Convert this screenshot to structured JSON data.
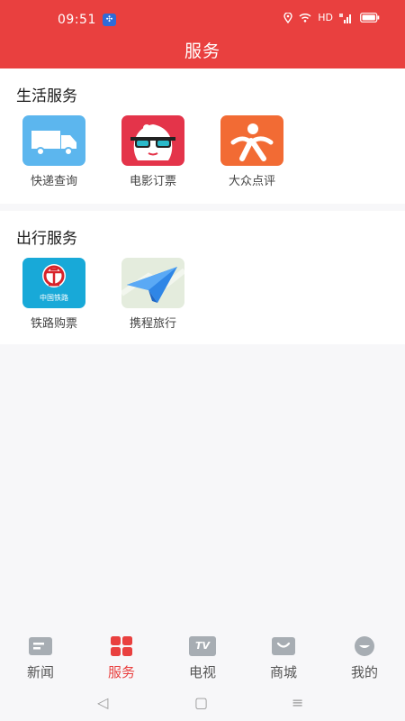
{
  "status": {
    "time": "09:51",
    "network": "HD"
  },
  "header": {
    "title": "服务"
  },
  "sections": [
    {
      "title": "生活服务",
      "items": [
        {
          "label": "快递查询",
          "icon": "delivery-truck-icon"
        },
        {
          "label": "电影订票",
          "icon": "movie-glasses-icon"
        },
        {
          "label": "大众点评",
          "icon": "dianping-icon"
        }
      ]
    },
    {
      "title": "出行服务",
      "items": [
        {
          "label": "铁路购票",
          "icon": "railway-icon",
          "icon_text": "中国铁路"
        },
        {
          "label": "携程旅行",
          "icon": "paper-plane-icon"
        }
      ]
    }
  ],
  "tabs": [
    {
      "label": "新闻",
      "active": false
    },
    {
      "label": "服务",
      "active": true
    },
    {
      "label": "电视",
      "active": false,
      "icon_text": "TV"
    },
    {
      "label": "商城",
      "active": false
    },
    {
      "label": "我的",
      "active": false
    }
  ],
  "system_nav": {
    "back": "◁",
    "home": "▢",
    "menu": "≡"
  },
  "colors": {
    "brand": "#e9403f",
    "tab_inactive": "#555555",
    "icon_gray": "#a7adb3"
  }
}
